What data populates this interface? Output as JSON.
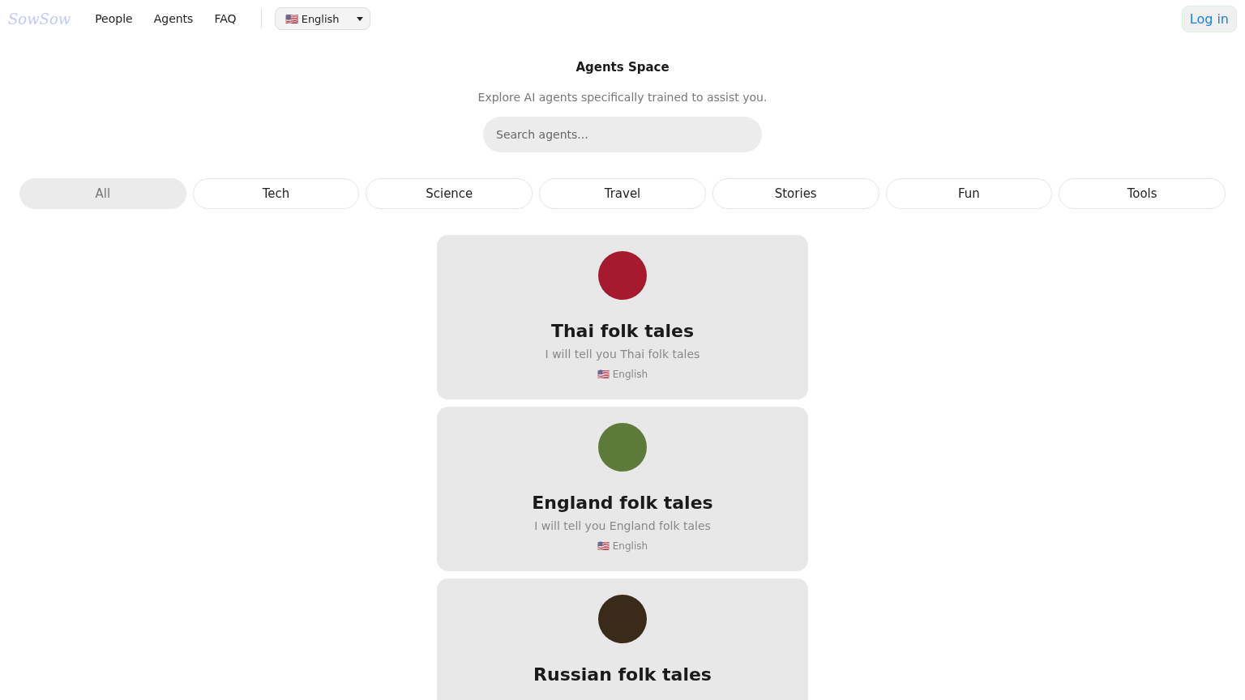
{
  "nav": {
    "logo": "SowSow",
    "links": [
      "People",
      "Agents",
      "FAQ"
    ],
    "language": "🇺🇸 English",
    "login": "Log in"
  },
  "header": {
    "title": "Agents Space",
    "subtitle": "Explore AI agents specifically trained to assist you.",
    "search": {
      "placeholder": "Search agents..."
    }
  },
  "categories": [
    {
      "label": "All",
      "selected": true
    },
    {
      "label": "Tech",
      "selected": false
    },
    {
      "label": "Science",
      "selected": false
    },
    {
      "label": "Travel",
      "selected": false
    },
    {
      "label": "Stories",
      "selected": false
    },
    {
      "label": "Fun",
      "selected": false
    },
    {
      "label": "Tools",
      "selected": false
    }
  ],
  "agents": [
    {
      "name": "Thai folk tales",
      "description": "I will tell you Thai folk tales",
      "language": "🇺🇸 English"
    },
    {
      "name": "England folk tales",
      "description": "I will tell you England folk tales",
      "language": "🇺🇸 English"
    },
    {
      "name": "Russian folk tales"
    }
  ]
}
